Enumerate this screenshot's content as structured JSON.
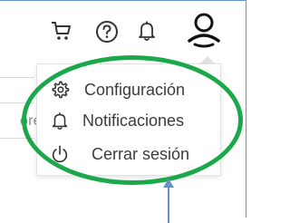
{
  "toolbar": {
    "icons": [
      "cart-icon",
      "help-icon",
      "bell-icon",
      "user-account-icon"
    ]
  },
  "background": {
    "fragment_text": "ore"
  },
  "user_menu": {
    "items": [
      {
        "label": "Configuración",
        "icon": "gear-icon"
      },
      {
        "label": "Notificaciones",
        "icon": "bell-icon"
      },
      {
        "label": "Cerrar sesión",
        "icon": "power-icon"
      }
    ]
  },
  "annotation": {
    "ellipse_color": "#1aa84a",
    "arrow_color": "#6b8fc7"
  },
  "colors": {
    "icon_color": "#333333",
    "menu_text": "#3c3c3c",
    "frame_border": "#6b8fc7"
  }
}
